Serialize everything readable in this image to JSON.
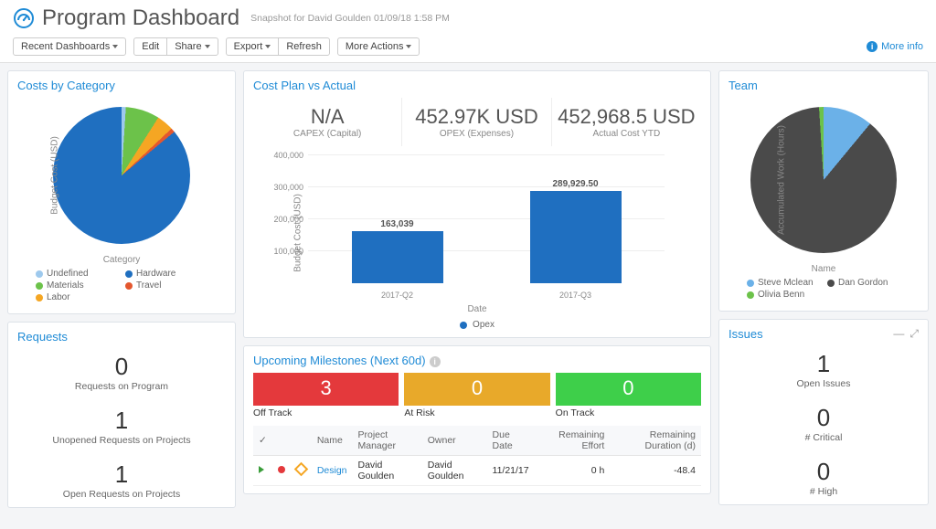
{
  "header": {
    "title": "Program Dashboard",
    "subtitle": "Snapshot for David Goulden 01/09/18 1:58 PM"
  },
  "toolbar": {
    "recent": "Recent Dashboards",
    "edit": "Edit",
    "share": "Share",
    "export": "Export",
    "refresh": "Refresh",
    "more_actions": "More Actions",
    "more_info": "More info"
  },
  "costs_card": {
    "title": "Costs by Category",
    "ylabel": "Budget Cost (USD)",
    "xlabel": "Category",
    "legend": {
      "undefined": "Undefined",
      "hardware": "Hardware",
      "materials": "Materials",
      "travel": "Travel",
      "labor": "Labor"
    }
  },
  "cost_plan_card": {
    "title": "Cost Plan vs Actual",
    "kpis": [
      {
        "value": "N/A",
        "sub": "CAPEX (Capital)"
      },
      {
        "value": "452.97K USD",
        "sub": "OPEX (Expenses)"
      },
      {
        "value": "452,968.5 USD",
        "sub": "Actual Cost YTD"
      }
    ],
    "ylabel": "Budget Cost (USD)",
    "xlabel": "Date",
    "legend_series": "Opex",
    "bars": [
      {
        "label": "163,039",
        "xtick": "2017-Q2"
      },
      {
        "label": "289,929.50",
        "xtick": "2017-Q3"
      }
    ],
    "yticks": [
      "100,000",
      "200,000",
      "300,000",
      "400,000"
    ]
  },
  "team_card": {
    "title": "Team",
    "ylabel": "Accumulated Work (Hours)",
    "xlabel": "Name",
    "legend": {
      "steve": "Steve Mclean",
      "dan": "Dan Gordon",
      "olivia": "Olivia Benn"
    }
  },
  "requests_card": {
    "title": "Requests",
    "stats": [
      {
        "num": "0",
        "label": "Requests on Program"
      },
      {
        "num": "1",
        "label": "Unopened Requests on Projects"
      },
      {
        "num": "1",
        "label": "Open Requests on Projects"
      }
    ]
  },
  "milestones_card": {
    "title": "Upcoming Milestones (Next 60d)",
    "tiles": [
      {
        "num": "3",
        "label": "Off Track",
        "color": "#e4393c"
      },
      {
        "num": "0",
        "label": "At Risk",
        "color": "#e8a92a"
      },
      {
        "num": "0",
        "label": "On Track",
        "color": "#3ecf4a"
      }
    ],
    "columns": {
      "name": "Name",
      "pm": "Project Manager",
      "owner": "Owner",
      "due": "Due Date",
      "effort": "Remaining Effort",
      "duration": "Remaining Duration (d)"
    },
    "row": {
      "name": "Design",
      "pm": "David Goulden",
      "owner": "David Goulden",
      "due": "11/21/17",
      "effort": "0 h",
      "duration": "-48.4"
    }
  },
  "issues_card": {
    "title": "Issues",
    "stats": [
      {
        "num": "1",
        "label": "Open Issues"
      },
      {
        "num": "0",
        "label": "# Critical"
      },
      {
        "num": "0",
        "label": "# High"
      }
    ]
  },
  "chart_data": [
    {
      "type": "pie",
      "title": "Costs by Category",
      "xlabel": "Category",
      "ylabel": "Budget Cost (USD)",
      "series": [
        {
          "name": "Hardware",
          "value": 85,
          "color": "#1f6fc0"
        },
        {
          "name": "Materials",
          "value": 8,
          "color": "#6cc24a"
        },
        {
          "name": "Labor",
          "value": 4,
          "color": "#f5a623"
        },
        {
          "name": "Undefined",
          "value": 2,
          "color": "#9ec9ed"
        },
        {
          "name": "Travel",
          "value": 1,
          "color": "#e4572e"
        }
      ]
    },
    {
      "type": "bar",
      "title": "Cost Plan vs Actual",
      "xlabel": "Date",
      "ylabel": "Budget Cost (USD)",
      "ylim": [
        0,
        400000
      ],
      "categories": [
        "2017-Q2",
        "2017-Q3"
      ],
      "series": [
        {
          "name": "Opex",
          "values": [
            163039,
            289929.5
          ],
          "color": "#1f6fc0"
        }
      ]
    },
    {
      "type": "pie",
      "title": "Team",
      "xlabel": "Name",
      "ylabel": "Accumulated Work (Hours)",
      "series": [
        {
          "name": "Dan Gordon",
          "value": 88,
          "color": "#4a4a4a"
        },
        {
          "name": "Steve Mclean",
          "value": 11,
          "color": "#6bb1e8"
        },
        {
          "name": "Olivia Benn",
          "value": 1,
          "color": "#6cc24a"
        }
      ]
    }
  ]
}
